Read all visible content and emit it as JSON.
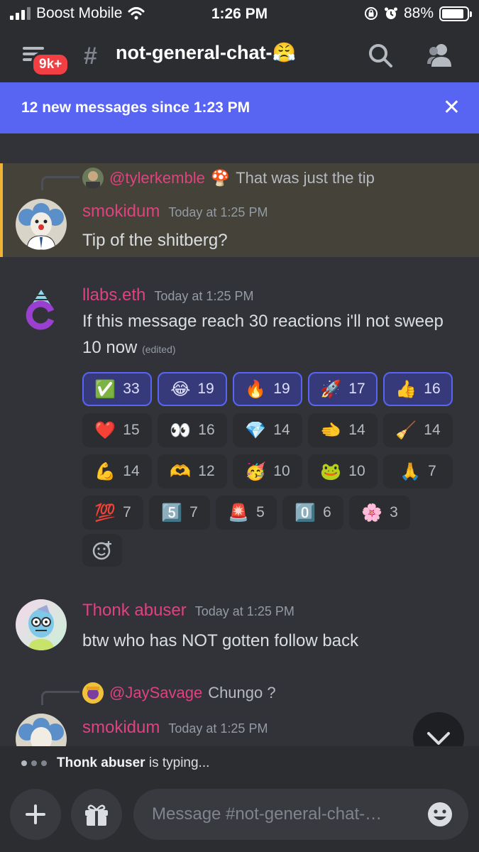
{
  "status_bar": {
    "carrier": "Boost Mobile",
    "time": "1:26 PM",
    "battery": "88%"
  },
  "header": {
    "unread_badge": "9k+",
    "channel_name": "not-general-chat-😤"
  },
  "banner": {
    "text": "12 new messages since 1:23 PM",
    "close_label": "✕"
  },
  "messages": [
    {
      "reply": {
        "mention": "@tylerkemble",
        "emoji": "🍄",
        "text": "That was just the tip"
      },
      "author": "smokidum",
      "timestamp": "Today at 1:25 PM",
      "text": "Tip of the shitberg?"
    },
    {
      "author": "llabs.eth",
      "timestamp": "Today at 1:25 PM",
      "text": "If this message reach 30 reactions i'll not sweep 10 now",
      "edited": "(edited)",
      "reactions": [
        {
          "emoji": "✅",
          "count": "33",
          "mine": true
        },
        {
          "emoji": "😂",
          "count": "19",
          "mine": true
        },
        {
          "emoji": "🔥",
          "count": "19",
          "mine": true
        },
        {
          "emoji": "🚀",
          "count": "17",
          "mine": true
        },
        {
          "emoji": "👍",
          "count": "16",
          "mine": true
        },
        {
          "emoji": "❤️",
          "count": "15",
          "mine": false
        },
        {
          "emoji": "👀",
          "count": "16",
          "mine": false
        },
        {
          "emoji": "💎",
          "count": "14",
          "mine": false
        },
        {
          "emoji": "🫲",
          "count": "14",
          "mine": false
        },
        {
          "emoji": "🧹",
          "count": "14",
          "mine": false
        },
        {
          "emoji": "💪",
          "count": "14",
          "mine": false
        },
        {
          "emoji": "🫶",
          "count": "12",
          "mine": false
        },
        {
          "emoji": "🥳",
          "count": "10",
          "mine": false
        },
        {
          "emoji": "🐸",
          "count": "10",
          "mine": false
        },
        {
          "emoji": "🙏",
          "count": "7",
          "mine": false
        },
        {
          "emoji": "💯",
          "count": "7",
          "mine": false
        },
        {
          "emoji": "5️⃣",
          "count": "7",
          "mine": false
        },
        {
          "emoji": "🚨",
          "count": "5",
          "mine": false
        },
        {
          "emoji": "0️⃣",
          "count": "6",
          "mine": false
        },
        {
          "emoji": "🌸",
          "count": "3",
          "mine": false
        }
      ]
    },
    {
      "author": "Thonk abuser",
      "timestamp": "Today at 1:25 PM",
      "text": "btw who has NOT gotten follow back"
    },
    {
      "reply": {
        "mention": "@JaySavage",
        "text": "Chungo ?"
      },
      "author": "smokidum",
      "timestamp": "Today at 1:25 PM"
    }
  ],
  "typing": {
    "user": "Thonk abuser",
    "suffix": "is typing..."
  },
  "composer": {
    "placeholder": "Message #not-general-chat-…"
  },
  "colors": {
    "accent": "#5865f2",
    "author": "#e0427f",
    "highlight": "#f0b232",
    "background": "#313338"
  }
}
